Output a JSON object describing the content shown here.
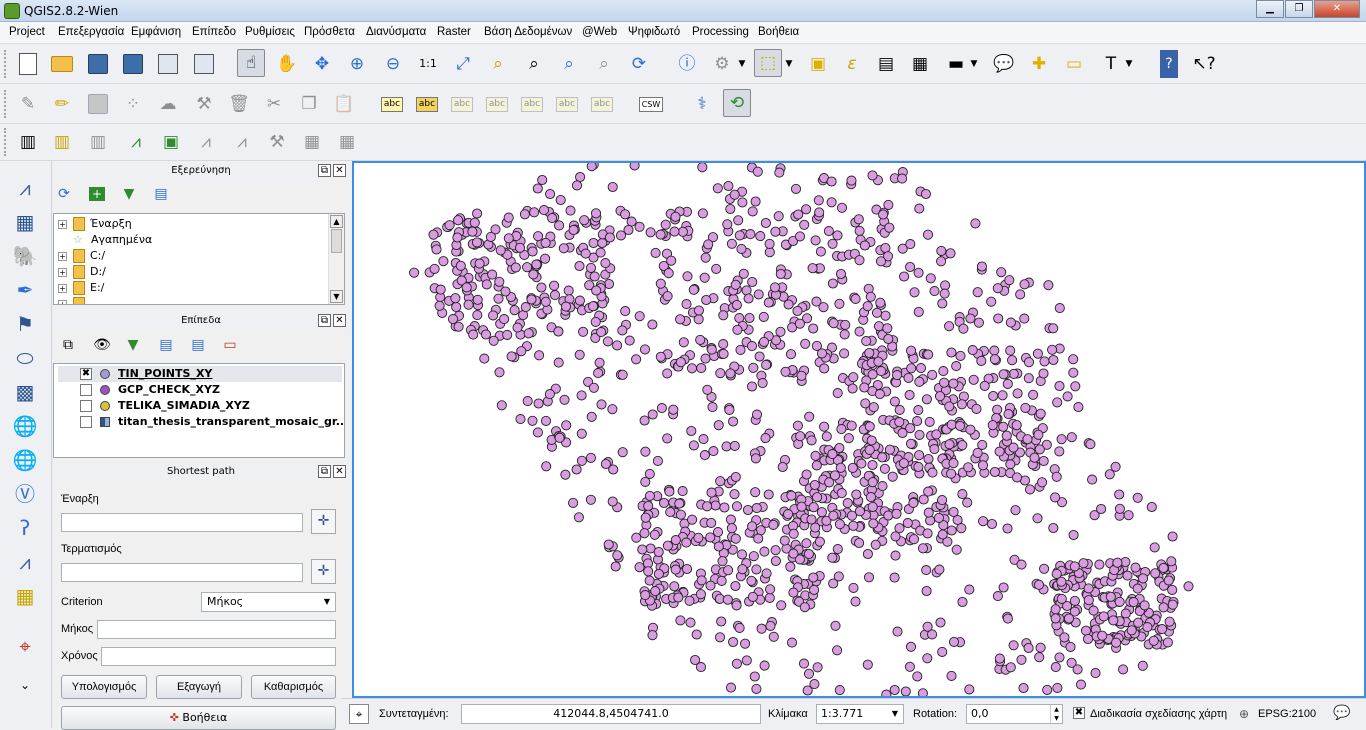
{
  "window": {
    "title": "QGIS2.8.2-Wien"
  },
  "menu": [
    "Project",
    "Επεξεργασία",
    "Εμφάνιση",
    "Επίπεδο",
    "Ρυθμίσεις",
    "Πρόσθετα",
    "Διανύσματα",
    "Raster",
    "Βάση Δεδομένων",
    "@Web",
    "Ψηφιδωτό",
    "Processing",
    "Βοήθεια"
  ],
  "toolbar": {
    "label_tools": [
      "abc",
      "abc",
      "abc",
      "abc",
      "abc",
      "abc",
      "abc"
    ],
    "csw": "CSW"
  },
  "browser": {
    "title": "Εξερεύνηση",
    "items": [
      "Έναρξη",
      "Αγαπημένα",
      "C:/",
      "D:/",
      "E:/"
    ]
  },
  "layers": {
    "title": "Επίπεδα",
    "items": [
      {
        "name": "TIN_POINTS_XY",
        "checked": "✖",
        "color": "#a09ad6"
      },
      {
        "name": "GCP_CHECK_XYZ",
        "checked": "",
        "color": "#a24fc7"
      },
      {
        "name": "TELIKA_SIMADIA_XYZ",
        "checked": "",
        "color": "#d9c13a"
      },
      {
        "name": "titan_thesis_transparent_mosaic_gr...",
        "checked": "",
        "color": "raster"
      }
    ]
  },
  "shortest_path": {
    "title": "Shortest path",
    "start_label": "Έναρξη",
    "end_label": "Τερματισμός",
    "criterion_label": "Criterion",
    "criterion_value": "Μήκος",
    "length_label": "Μήκος",
    "time_label": "Χρόνος",
    "calculate": "Υπολογισμός",
    "export": "Εξαγωγή",
    "clear": "Καθαρισμός",
    "help": "Βοήθεια"
  },
  "status": {
    "coord_label": "Συντεταγμένη:",
    "coord_value": "412044.8,4504741.0",
    "scale_label": "Κλίμακα",
    "scale_value": "1:3.771",
    "rotation_label": "Rotation:",
    "rotation_value": "0,0",
    "render_label": "Διαδικασία σχεδίασης χάρτη",
    "render_checked": "✖",
    "crs": "EPSG:2100"
  },
  "map": {
    "point_fill": "#d99ce0",
    "point_stroke": "#222222",
    "canvas_border": "#3c8ee0"
  }
}
